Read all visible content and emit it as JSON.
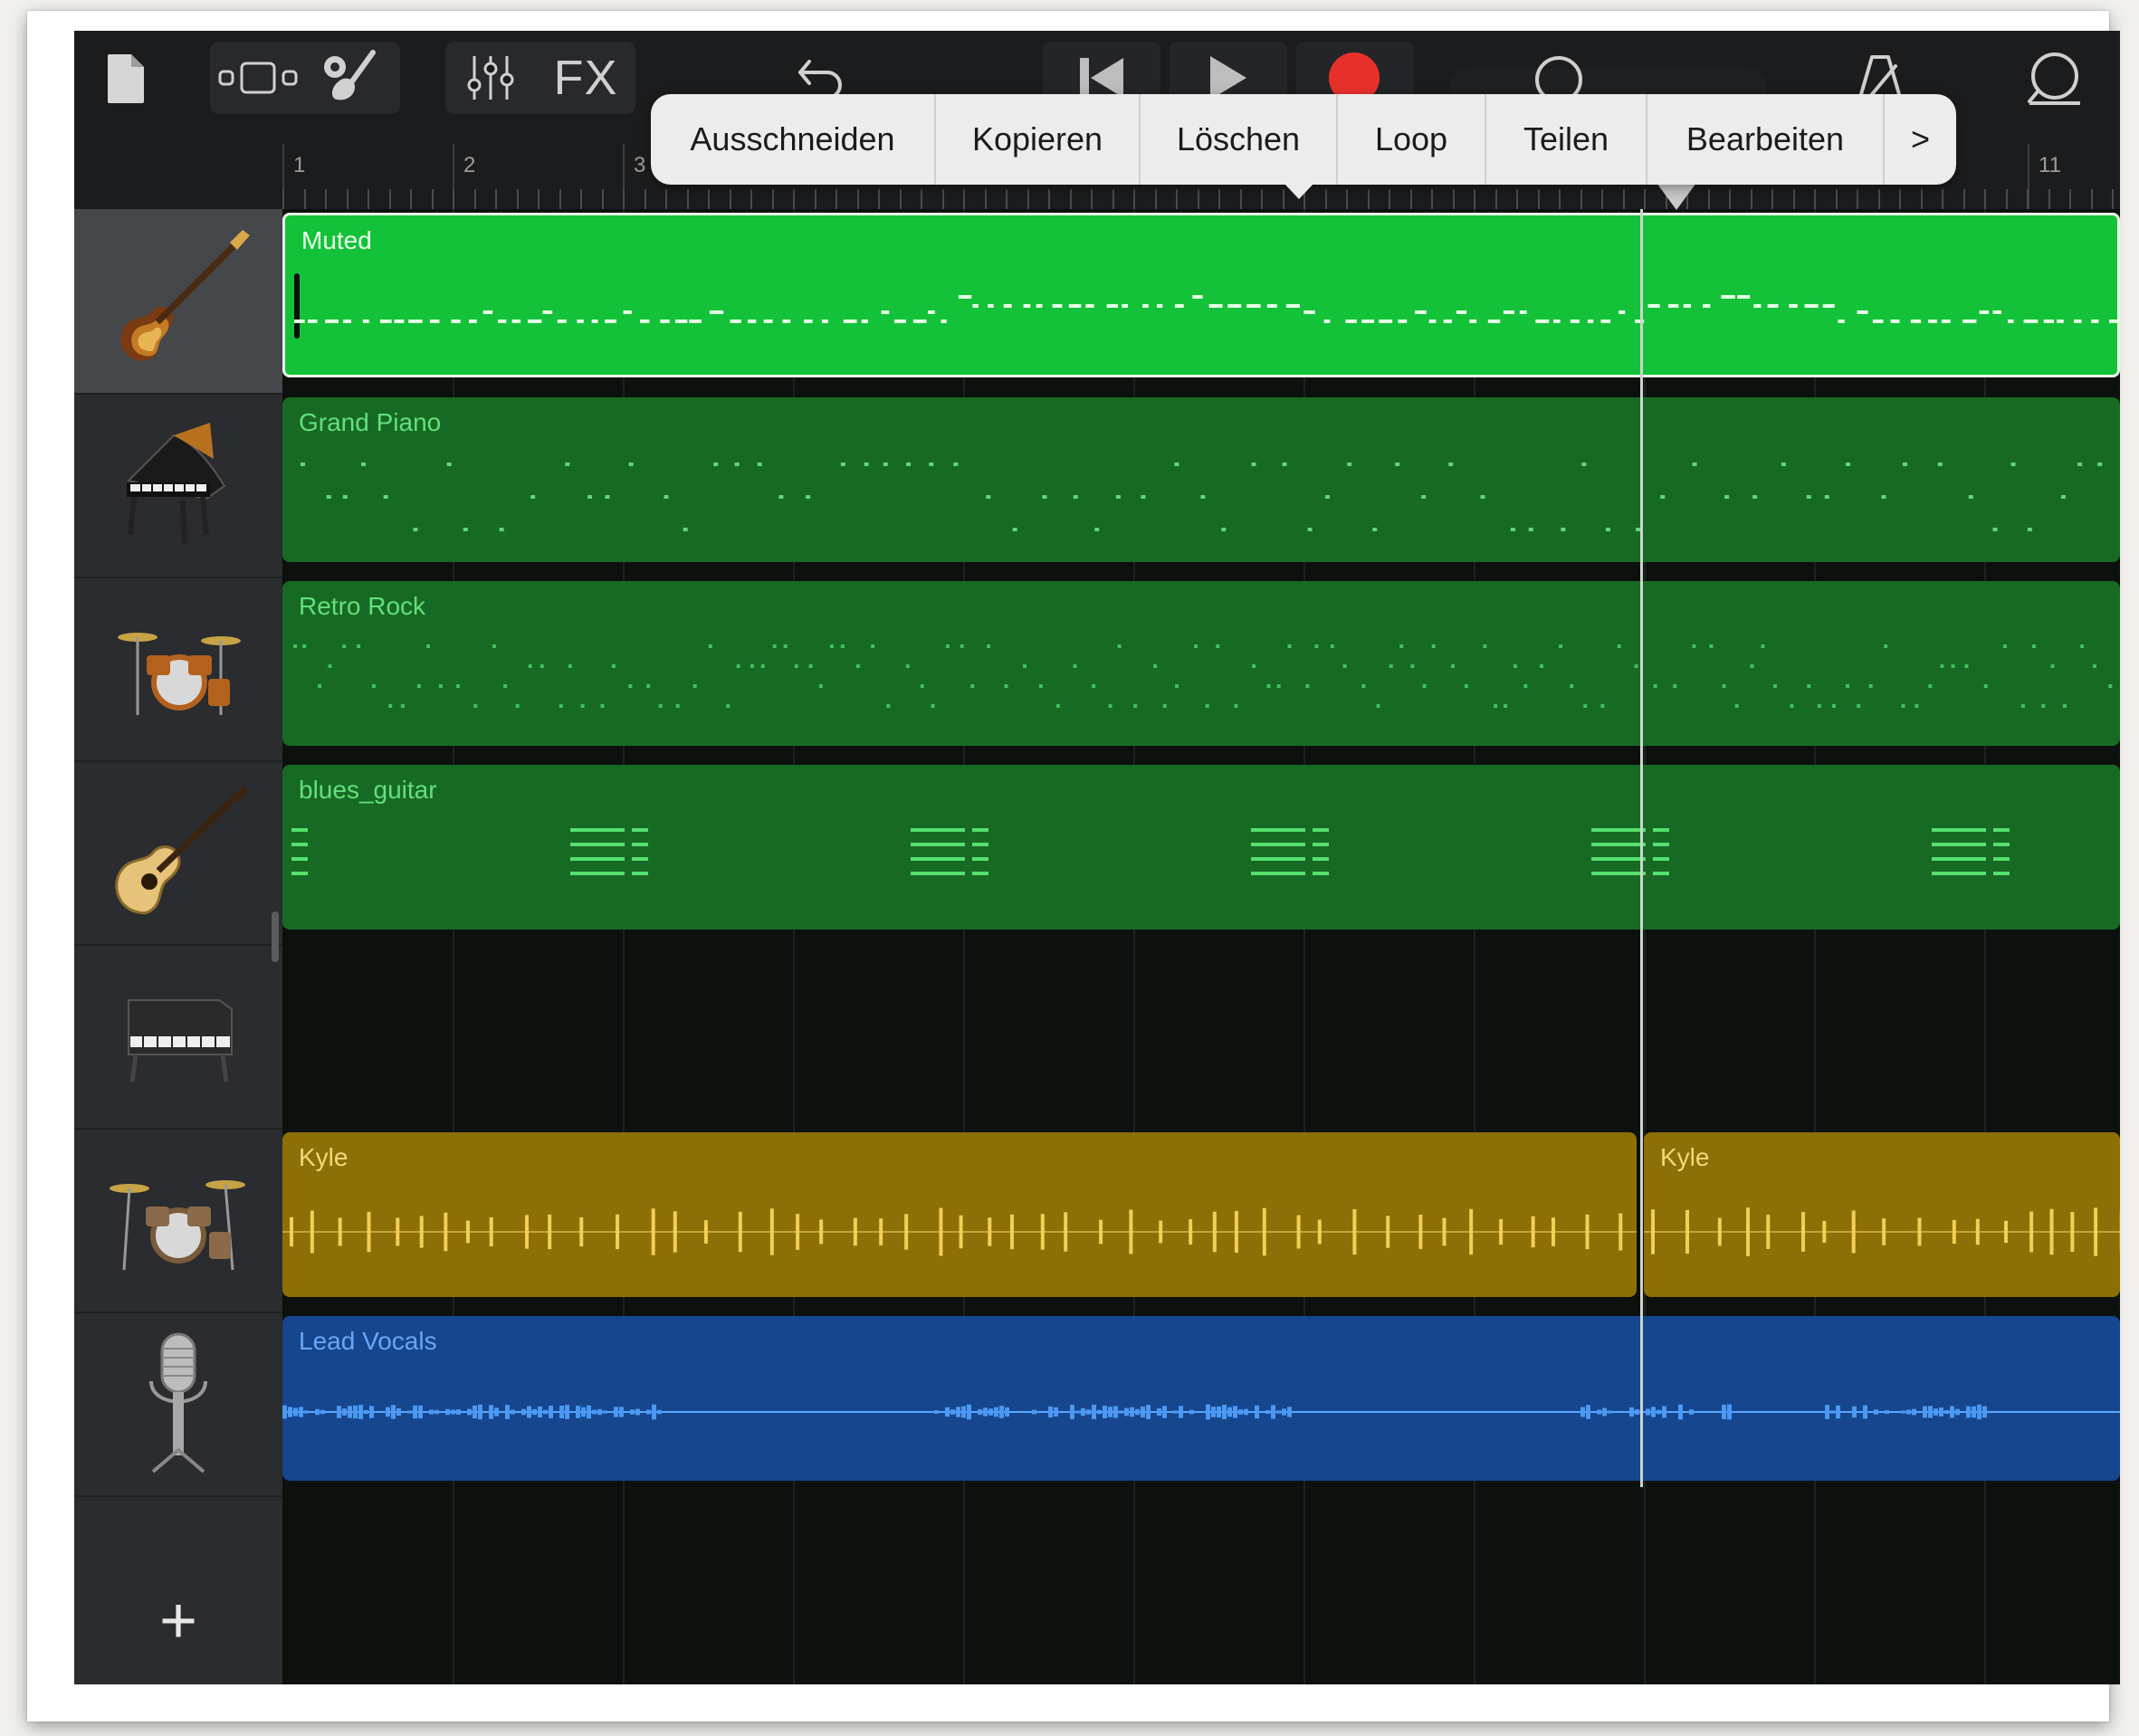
{
  "toolbar": {
    "fx_label": "FX",
    "record_color": "#e8302b",
    "icons": [
      "document-icon",
      "track-view-icon",
      "smart-controls-icon",
      "mixer-icon",
      "fx-button",
      "undo-icon",
      "rewind-icon",
      "play-icon",
      "record-icon",
      "metronome-icon",
      "loop-browser-icon"
    ]
  },
  "ruler": {
    "bars": [
      {
        "n": "1"
      },
      {
        "n": "2"
      },
      {
        "n": "3"
      },
      {
        "n": "11"
      }
    ]
  },
  "popover": {
    "items": [
      "Ausschneiden",
      "Kopieren",
      "Löschen",
      "Loop",
      "Teilen",
      "Bearbeiten"
    ],
    "more_label": ">"
  },
  "tracks": [
    {
      "instrument": "bass-guitar-icon",
      "region": "Muted",
      "color": "#14c23a",
      "selected": true
    },
    {
      "instrument": "grand-piano-icon",
      "region": "Grand Piano",
      "color": "#176a24"
    },
    {
      "instrument": "drum-kit-icon",
      "region": "Retro Rock",
      "color": "#176a24"
    },
    {
      "instrument": "acoustic-guitar-icon",
      "region": "blues_guitar",
      "color": "#176a24"
    },
    {
      "instrument": "electric-piano-icon",
      "region": "",
      "color": ""
    },
    {
      "instrument": "drum-kit-icon",
      "region": "Kyle",
      "region2": "Kyle",
      "color": "#8c6f07"
    },
    {
      "instrument": "microphone-icon",
      "region": "Lead Vocals",
      "color": "#15468e"
    }
  ],
  "add_track_label": "+"
}
